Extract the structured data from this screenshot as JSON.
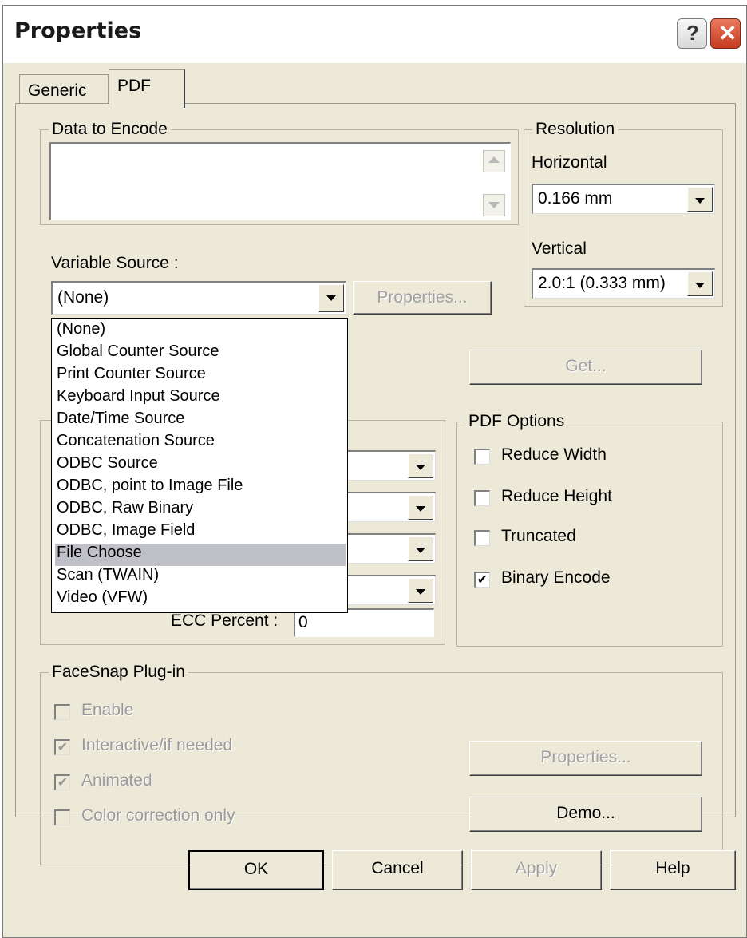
{
  "window": {
    "title": "Properties"
  },
  "tabs": [
    {
      "label": "Generic"
    },
    {
      "label": "PDF"
    }
  ],
  "data_to_encode": {
    "label": "Data to Encode",
    "value": ""
  },
  "resolution": {
    "label": "Resolution",
    "horizontal_label": "Horizontal",
    "horizontal_value": "0.166 mm",
    "vertical_label": "Vertical",
    "vertical_value": "2.0:1 (0.333 mm)"
  },
  "variable_source": {
    "label": "Variable Source :",
    "selected": "(None)",
    "properties_button": "Properties...",
    "options": [
      "(None)",
      "Global Counter Source",
      "Print Counter Source",
      "Keyboard Input Source",
      "Date/Time Source",
      "Concatenation Source",
      "ODBC Source",
      "ODBC, point to Image File",
      "ODBC, Raw Binary",
      "ODBC, Image Field",
      "File Choose",
      "Scan (TWAIN)",
      "Video (VFW)"
    ],
    "highlighted": "File Choose"
  },
  "get_button": "Get...",
  "ecc": {
    "label": "ECC Percent :",
    "value": "0"
  },
  "pdf_options": {
    "label": "PDF Options",
    "items": [
      {
        "label": "Reduce Width",
        "checked": false
      },
      {
        "label": "Reduce Height",
        "checked": false
      },
      {
        "label": "Truncated",
        "checked": false
      },
      {
        "label": "Binary Encode",
        "checked": true
      }
    ]
  },
  "facesnap": {
    "label": "FaceSnap Plug-in",
    "items": [
      {
        "label": "Enable",
        "checked": false
      },
      {
        "label": "Interactive/if needed",
        "checked": true
      },
      {
        "label": "Animated",
        "checked": true
      },
      {
        "label": "Color correction only",
        "checked": false
      }
    ],
    "properties_button": "Properties...",
    "demo_button": "Demo..."
  },
  "footer": {
    "ok": "OK",
    "cancel": "Cancel",
    "apply": "Apply",
    "help": "Help"
  },
  "colors": {
    "dialog_bg": "#ece9d8",
    "close_red": "#c63b20",
    "selection": "#c0c0c8"
  }
}
